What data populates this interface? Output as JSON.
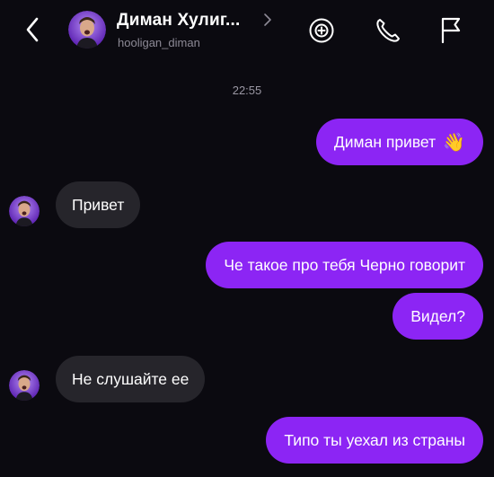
{
  "header": {
    "name": "Диман Хулиг...",
    "username": "hooligan_diman",
    "back_icon": "chevron-left-icon",
    "chevron_icon": "chevron-right-icon",
    "actions": [
      "sticker-add-icon",
      "phone-icon",
      "flag-icon"
    ]
  },
  "chat": {
    "timestamp": "22:55",
    "messages": [
      {
        "direction": "out",
        "text": "Диман привет",
        "emoji": "👋"
      },
      {
        "direction": "in",
        "text": "Привет"
      },
      {
        "direction": "out",
        "text": "Че такое про тебя Черно говорит"
      },
      {
        "direction": "out",
        "text": "Видел?"
      },
      {
        "direction": "in",
        "text": "Не слушайте ее"
      },
      {
        "direction": "out",
        "text": "Типо ты уехал из страны"
      }
    ]
  },
  "colors": {
    "background": "#0b0a10",
    "outgoing_bubble": "#8c25f4",
    "incoming_bubble": "#26252b",
    "secondary_text": "#8d8a96"
  }
}
